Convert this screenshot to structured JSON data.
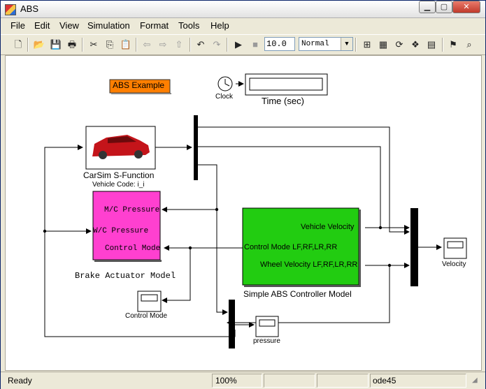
{
  "window": {
    "title": "ABS"
  },
  "menu": [
    "File",
    "Edit",
    "View",
    "Simulation",
    "Format",
    "Tools",
    "Help"
  ],
  "toolbar": {
    "stop_time": "10.0",
    "sim_mode": "Normal"
  },
  "status": {
    "left": "Ready",
    "zoom": "100%",
    "solver": "ode45"
  },
  "blocks": {
    "abs_example": "ABS Example",
    "clock": "Clock",
    "time_display": "Time (sec)",
    "carsim_title": "CarSim S-Function",
    "carsim_sub": "Vehicle Code: i_i",
    "brake": {
      "title": "Brake Actuator Model",
      "port1": "M/C Pressure",
      "port2": "W/C Pressure",
      "port3": "Control Mode"
    },
    "abs": {
      "title": "Simple ABS Controller Model",
      "port1": "Vehicle Velocity",
      "port2": "Control Mode LF,RF,LR,RR",
      "port3": "Wheel Velocity LF,RF,LR,RR"
    },
    "control_mode_scope": "Control Mode",
    "pressure_scope": "pressure",
    "velocity_scope": "Velocity"
  },
  "colors": {
    "brake_fill": "#ff40d0",
    "abs_fill": "#22cc11",
    "label_fill": "#ff7f00"
  }
}
